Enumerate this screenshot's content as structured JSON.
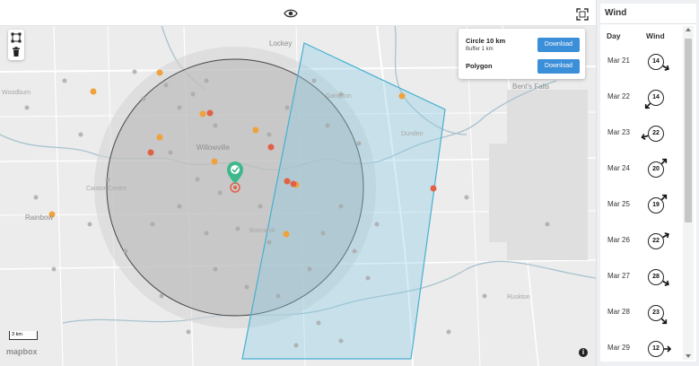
{
  "map": {
    "places": [
      {
        "name": "Lockey",
        "style": "big"
      },
      {
        "name": "Willowville",
        "style": "big"
      },
      {
        "name": "Caistor Centre",
        "style": "small"
      },
      {
        "name": "Rainbow",
        "style": "big"
      },
      {
        "name": "Bismarck",
        "style": "small"
      },
      {
        "name": "Bent's Falls",
        "style": "big"
      },
      {
        "name": "Woodburn",
        "style": "small"
      },
      {
        "name": "Gampton",
        "style": "small"
      },
      {
        "name": "Dunden",
        "style": "small"
      },
      {
        "name": "Ruskton",
        "style": "small"
      }
    ],
    "scale_label": "3 km",
    "attribution": "mapbox",
    "info_symbol": "i"
  },
  "popup": {
    "circle_title": "Circle 10 km",
    "circle_subtitle": "Buffer 1 km",
    "polygon_title": "Polygon",
    "download_label": "Download"
  },
  "wind_panel": {
    "title": "Wind",
    "col_day": "Day",
    "col_wind": "Wind",
    "rows": [
      {
        "day": "Mar 21",
        "speed": "14",
        "direction_deg": 120
      },
      {
        "day": "Mar 22",
        "speed": "14",
        "direction_deg": 225
      },
      {
        "day": "Mar 23",
        "speed": "22",
        "direction_deg": 255
      },
      {
        "day": "Mar 24",
        "speed": "20",
        "direction_deg": 45
      },
      {
        "day": "Mar 25",
        "speed": "19",
        "direction_deg": 45
      },
      {
        "day": "Mar 26",
        "speed": "22",
        "direction_deg": 60
      },
      {
        "day": "Mar 27",
        "speed": "28",
        "direction_deg": 120
      },
      {
        "day": "Mar 28",
        "speed": "23",
        "direction_deg": 135
      },
      {
        "day": "Mar 29",
        "speed": "12",
        "direction_deg": 90
      }
    ]
  },
  "colors": {
    "accent": "#3b8ed8",
    "marker": "#3fb98c",
    "polygon": "#47afd2",
    "incident_orange": "#f0a23c",
    "incident_red": "#e16146"
  },
  "icons": {
    "visibility": "eye-icon",
    "fullscreen": "fullscreen-icon",
    "draw_polygon": "draw-polygon-icon",
    "delete": "trash-icon",
    "location_marker": "location-pin-icon",
    "wind_direction": "arrow-icon"
  }
}
